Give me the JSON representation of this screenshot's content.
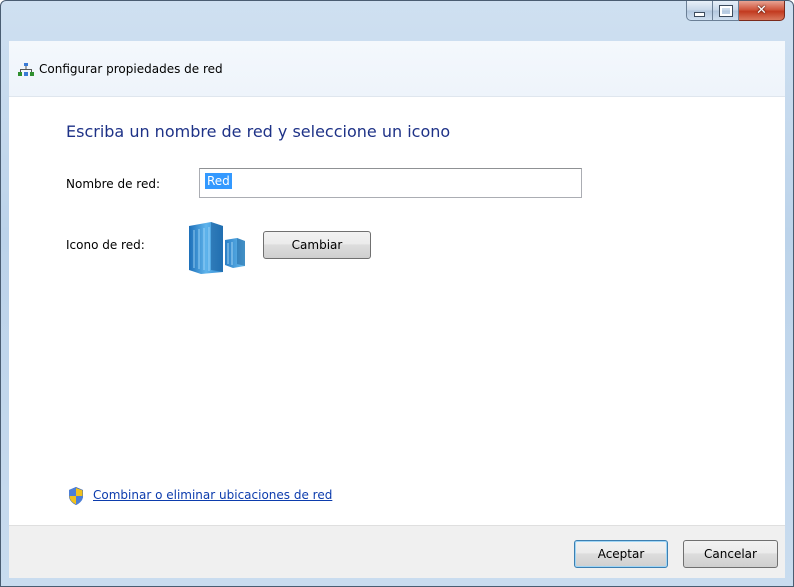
{
  "window": {
    "title": "Configurar propiedades de red",
    "caption_icons": [
      "minimize-icon",
      "maximize-icon",
      "close-icon"
    ]
  },
  "main": {
    "heading": "Escriba un nombre de red y seleccione un icono",
    "network_name_label": "Nombre de red:",
    "network_name_value": "Red",
    "network_icon_label": "Icono de red:",
    "change_button_label": "Cambiar",
    "merge_link_label": "Combinar o eliminar ubicaciones de red"
  },
  "footer": {
    "accept_label": "Aceptar",
    "cancel_label": "Cancelar"
  },
  "colors": {
    "heading": "#1e3287",
    "link": "#0c3cad",
    "selection": "#3399ff",
    "close_button": "#c23a1f"
  }
}
